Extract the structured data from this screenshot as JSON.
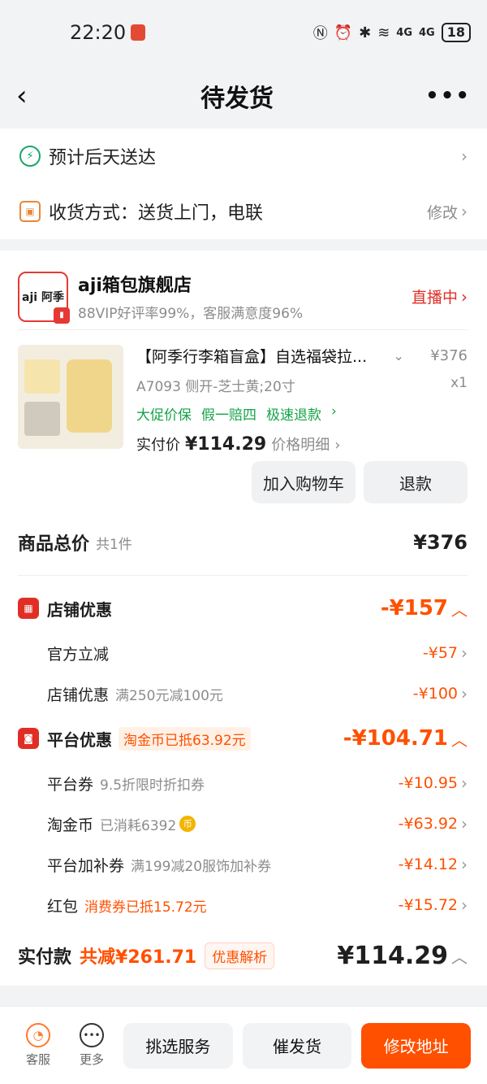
{
  "status": {
    "time": "22:20",
    "battery": "18",
    "signal1": "4G",
    "signal2": "4G"
  },
  "nav": {
    "title": "待发货"
  },
  "delivery": {
    "eta": "预计后天送达",
    "method": "收货方式：送货上门，电联",
    "modify": "修改"
  },
  "store": {
    "logo": "aji 阿季",
    "name": "aji箱包旗舰店",
    "sub": "88VIP好评率99%，客服满意度96%",
    "live": "直播中"
  },
  "product": {
    "title": "【阿季行李箱盲盒】自选福袋拉...",
    "price": "¥376",
    "spec": "A7093 侧开-芝士黄;20寸",
    "qty": "x1",
    "tags": [
      "大促价保",
      "假一赔四",
      "极速退款"
    ],
    "real_label": "实付价",
    "real_price": "¥114.29",
    "price_detail": "价格明细",
    "add_cart": "加入购物车",
    "refund": "退款"
  },
  "summary": {
    "goods_total_label": "商品总价",
    "goods_count": "共1件",
    "goods_total": "¥376",
    "shop": {
      "label": "店铺优惠",
      "amount": "-¥157",
      "items": [
        {
          "label": "官方立减",
          "note": "",
          "amount": "-¥57"
        },
        {
          "label": "店铺优惠",
          "note": "满250元减100元",
          "amount": "-¥100"
        }
      ]
    },
    "platform": {
      "label": "平台优惠",
      "pill": "淘金币已抵63.92元",
      "amount": "-¥104.71",
      "items": [
        {
          "label": "平台券",
          "note": "9.5折限时折扣券",
          "amount": "-¥10.95"
        },
        {
          "label": "淘金币",
          "note": "已消耗6392",
          "amount": "-¥63.92"
        },
        {
          "label": "平台加补券",
          "note": "满199减20服饰加补券",
          "amount": "-¥14.12"
        },
        {
          "label": "红包",
          "note": "消费券已抵15.72元",
          "amount": "-¥15.72"
        }
      ]
    },
    "final_label": "实付款",
    "reduce": "共减¥261.71",
    "analysis": "优惠解析",
    "total": "¥114.29"
  },
  "bottom": {
    "service": "客服",
    "more": "更多",
    "select_service": "挑选服务",
    "urge": "催发货",
    "change_address": "修改地址"
  },
  "colors": {
    "accent": "#ff5000",
    "red": "#e02e24",
    "green": "#16a34a"
  }
}
